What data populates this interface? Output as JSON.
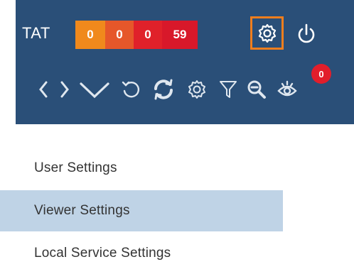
{
  "toolbar": {
    "tat_label": "TAT",
    "counters": [
      {
        "value": "0",
        "color": "#f0891c"
      },
      {
        "value": "0",
        "color": "#e6572a"
      },
      {
        "value": "0",
        "color": "#e0212a"
      },
      {
        "value": "59",
        "color": "#d8182a"
      }
    ],
    "settings_icon": "gear-icon",
    "power_icon": "power-icon",
    "tools": [
      "chevron-left-icon",
      "chevron-right-icon",
      "chevron-down-icon",
      "undo-icon",
      "refresh-icon",
      "gear-icon",
      "filter-icon",
      "zoom-out-icon",
      "eye-icon"
    ],
    "notification_badge": "0",
    "background_color": "#2a4f78",
    "highlight_color": "#f07e1d"
  },
  "menu": {
    "items": [
      {
        "label": "User Settings",
        "selected": false
      },
      {
        "label": "Viewer Settings",
        "selected": true
      },
      {
        "label": "Local Service Settings",
        "selected": false
      }
    ],
    "selected_color": "#bfd3e6"
  }
}
